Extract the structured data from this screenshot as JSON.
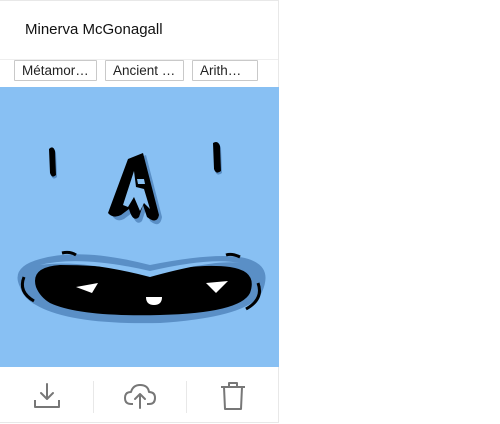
{
  "card": {
    "title": "Minerva McGonagall",
    "tags": [
      "Métamorphose",
      "Ancient Runes",
      "Arithmancy"
    ],
    "image": {
      "description_icon": "monster-face-image",
      "background": "#88c0f3"
    },
    "actions": [
      {
        "icon": "download-icon"
      },
      {
        "icon": "cloud-upload-icon"
      },
      {
        "icon": "trash-icon"
      }
    ]
  }
}
